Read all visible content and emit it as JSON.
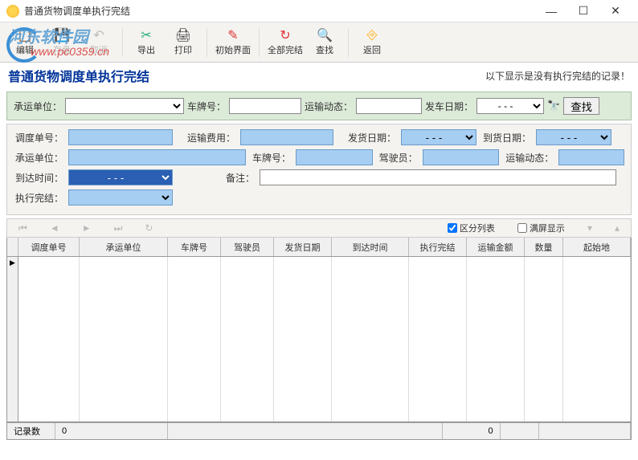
{
  "titlebar": {
    "title": "普通货物调度单执行完结"
  },
  "watermark": {
    "text": "河东软件园",
    "url": "www.pc0359.cn"
  },
  "toolbar": {
    "edit": "编辑",
    "save": "存盘",
    "cancel": "取消",
    "export": "导出",
    "print": "打印",
    "reset": "初始界面",
    "finish_all": "全部完结",
    "find": "查找",
    "return": "返回"
  },
  "header": {
    "title": "普通货物调度单执行完结",
    "note": "以下显示是没有执行完结的记录！"
  },
  "search": {
    "carrier_label": "承运单位：",
    "plate_label": "车牌号：",
    "transport_status_label": "运输动态：",
    "dispatch_date_label": "发车日期：",
    "date_placeholder": "- - -",
    "search_btn": "查找"
  },
  "detail": {
    "order_no_label": "调度单号：",
    "freight_label": "运输费用：",
    "ship_date_label": "发货日期：",
    "arrive_date_label": "到货日期：",
    "carrier_label": "承运单位：",
    "plate_label": "车牌号：",
    "driver_label": "驾驶员：",
    "transport_status_label": "运输动态：",
    "arrive_time_label": "到达时间：",
    "remark_label": "备注：",
    "exec_finish_label": "执行完结：",
    "date_placeholder": "- - -"
  },
  "checkboxes": {
    "split_list": "区分列表",
    "fullscreen": "满屏显示"
  },
  "grid": {
    "columns": [
      "调度单号",
      "承运单位",
      "车牌号",
      "驾驶员",
      "发货日期",
      "到达时间",
      "执行完结",
      "运输金额",
      "数量",
      "起始地"
    ]
  },
  "footer": {
    "record_label": "记录数",
    "record_count": "0",
    "zero": "0"
  }
}
